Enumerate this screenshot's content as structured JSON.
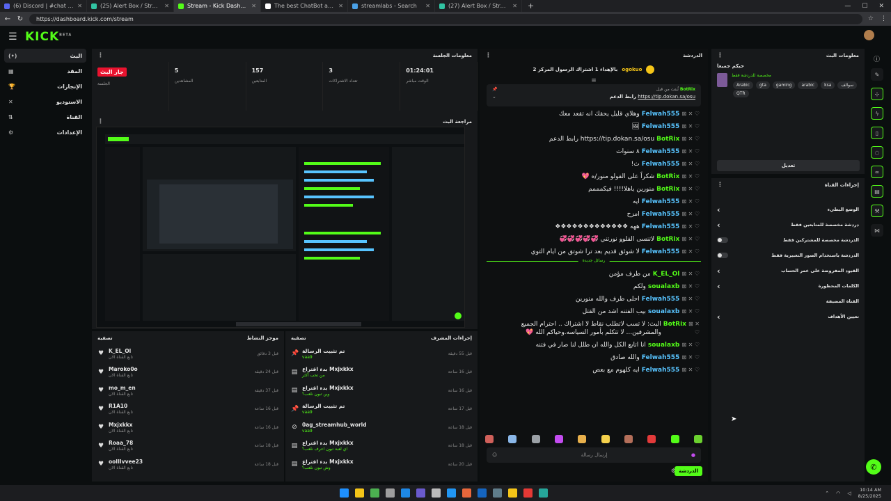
{
  "browser": {
    "tabs": [
      {
        "title": "(6) Discord | #chat | Vaa9",
        "color": "#5865f2",
        "active": false
      },
      {
        "title": "(25) Alert Box / Streamlabs",
        "color": "#31c3a2",
        "active": false
      },
      {
        "title": "Stream - Kick Dashboard",
        "color": "#53fc18",
        "active": true
      },
      {
        "title": "The best ChatBot and Widgets fo",
        "color": "#ffffff",
        "active": false
      },
      {
        "title": "streamlabs - Search",
        "color": "#4aa0e6",
        "active": false
      },
      {
        "title": "(27) Alert Box / Streamlabs",
        "color": "#31c3a2",
        "active": false
      }
    ],
    "url": "https://dashboard.kick.com/stream"
  },
  "app": {
    "logo": "KICK",
    "logo_sup": "BETA"
  },
  "sidebar": {
    "items": [
      {
        "label": "البث",
        "icon": "(•)"
      },
      {
        "label": "المقد",
        "icon": "▦"
      },
      {
        "label": "الإنجازات",
        "icon": "🏆"
      },
      {
        "label": "الاستوديو",
        "icon": "✕"
      },
      {
        "label": "القناة",
        "icon": "⇅"
      },
      {
        "label": "الإعدادات",
        "icon": "⚙"
      }
    ]
  },
  "session": {
    "title": "معلومات الجلسة",
    "stats": [
      {
        "value": "جار البث",
        "label": "الجلسة",
        "badge": true
      },
      {
        "value": "5",
        "label": "المشاهدين"
      },
      {
        "value": "157",
        "label": "المتابعين"
      },
      {
        "value": "3",
        "label": "تعداد الاشتراكات"
      },
      {
        "value": "01:24:01",
        "label": "الوقت مباشر"
      }
    ]
  },
  "preview": {
    "title": "مراجعة البث"
  },
  "activity": {
    "title": "موجز النشاط",
    "filter": "تصفية",
    "items": [
      {
        "name": "K_EL_Ol",
        "sub": "تابع القناة الان",
        "time": "قبل 3 دقائق"
      },
      {
        "name": "Maroko0o",
        "sub": "تابع القناة الان",
        "time": "قبل 24 دقيقة"
      },
      {
        "name": "mo_m_en",
        "sub": "تابع القناة الان",
        "time": "قبل 37 دقيقة"
      },
      {
        "name": "R1A10",
        "sub": "تابع القناة الان",
        "time": "قبل 16 ساعة"
      },
      {
        "name": "Mxjxkkx",
        "sub": "تابع القناة الان",
        "time": "قبل 16 ساعة"
      },
      {
        "name": "Roaa_78",
        "sub": "تابع القناة الان",
        "time": "قبل 18 ساعة"
      },
      {
        "name": "ooIIIvvee23",
        "sub": "تابع القناة الان",
        "time": "قبل 18 ساعة"
      }
    ]
  },
  "modlog": {
    "title": "إجراءات المشرف",
    "filter": "تصفية",
    "items": [
      {
        "icon": "📌",
        "name": "تم تثبيت الرسالة",
        "sub": "vaa9",
        "time": "قبل 55 دقيقة"
      },
      {
        "icon": "▤",
        "name": "بدء اقتراع Mxjxkkx",
        "sub": "من تحب أكثر",
        "time": "قبل 16 ساعة"
      },
      {
        "icon": "▤",
        "name": "بدء اقتراع Mxjxkkx",
        "sub": "وين تبون نلعب؟",
        "time": "قبل 16 ساعة"
      },
      {
        "icon": "📌",
        "name": "تم تثبيت الرسالة",
        "sub": "vaa9",
        "time": "قبل 17 ساعة"
      },
      {
        "icon": "⊘",
        "name": "0ag_streamhub_world",
        "sub": "vaa9",
        "time": "قبل 18 ساعة"
      },
      {
        "icon": "▤",
        "name": "بدء اقتراع Mxjxkkx",
        "sub": "اي لعبة تبون اعرف نلعب؟",
        "time": "قبل 18 ساعة"
      },
      {
        "icon": "▤",
        "name": "بدء اقتراع Mxjxkkx",
        "sub": "وش تبون نلعب؟",
        "time": "قبل 20 ساعة"
      }
    ]
  },
  "chat": {
    "title": "الدردشة",
    "gifter": {
      "name": "ogokuo",
      "count": "1",
      "text": "بالإهداء 1 اشتراك الرسول المركز 2"
    },
    "pinned": {
      "by": "BotRix",
      "tag": "ثُبتت من قبل",
      "link": "https://tip.dokan.sa/osu",
      "label": "رابط الدعم"
    },
    "messages": [
      {
        "user": "Felwah555",
        "text": "وهلاي قليل يحقك انه تقعد معك",
        "color": "blue"
      },
      {
        "user": "Felwah555",
        "text": "🖼",
        "color": "blue"
      },
      {
        "user": "BotRix",
        "text": "https://tip.dokan.sa/osu رابط الدعم",
        "color": "green"
      },
      {
        "user": "Felwah555",
        "text": "٨ سنوات",
        "color": "blue"
      },
      {
        "user": "Felwah555",
        "text": "ث!",
        "color": "blue"
      },
      {
        "user": "BotRix",
        "text": "شكراً على الفولو منور/ه 💖",
        "color": "green"
      },
      {
        "user": "BotRix",
        "text": "منورين ياهلا!!!! فيكمممم",
        "color": "green"
      },
      {
        "user": "Felwah555",
        "text": "ايه",
        "color": "blue"
      },
      {
        "user": "Felwah555",
        "text": "امزح",
        "color": "blue"
      },
      {
        "user": "Felwah555",
        "text": "ههه ❖❖❖❖❖❖❖❖❖❖❖❖❖",
        "color": "blue"
      },
      {
        "user": "BotRix",
        "text": "لاتنسى الفلوو نورتني 💞💞💞💞💞",
        "color": "green"
      },
      {
        "user": "Felwah555",
        "text": "لا شوئق قديم بعد ترا شوتق من ايام التوي",
        "color": "blue"
      }
    ],
    "new_divider": "رسائل جديدة",
    "messages2": [
      {
        "user": "K_EL_Ol",
        "text": "من طرف مؤمن",
        "color": "green"
      },
      {
        "user": "soualaxb",
        "text": "ولكم",
        "color": "green"
      },
      {
        "user": "Felwah555",
        "text": "احلى طرف والله منورين",
        "color": "blue"
      },
      {
        "user": "soualaxb",
        "text": "بيب الفتنه اشد من القتل",
        "color": "blue"
      },
      {
        "user": "BotRix",
        "text": "البث: لا تسب لاتطلب نقاط لا اشتراك .. احترام الجميع والمشرفين... لا تتكلم بأمور السياسه.وحياكم الله 💖",
        "color": "green"
      },
      {
        "user": "soualaxb",
        "text": "انا اتابع الكل والله ان طلل لنا صار في فتنه",
        "color": "green"
      },
      {
        "user": "Felwah555",
        "text": "والله صادق",
        "color": "blue"
      },
      {
        "user": "Felwah555",
        "text": "ايه كلهوم مع بعض",
        "color": "blue"
      }
    ],
    "placeholder": "إرسال رسالة",
    "send": "الدردشة"
  },
  "stream_info": {
    "title": "معلومات البث",
    "stream_title": "حيكم جميعا",
    "category": "مخصصة للدردشة فقط",
    "tags": [
      "Arabic",
      "gta",
      "gaming",
      "arabic",
      "ksa",
      "سوالف",
      "QTR"
    ],
    "edit": "تعديل"
  },
  "channel_actions": {
    "title": "إجراءات القناة",
    "items": [
      {
        "label": "الوضع البطيء",
        "type": "arrow"
      },
      {
        "label": "دردشة مخصصة للمتابعين فقط",
        "type": "arrow"
      },
      {
        "label": "الدردشة مخصصة للمشتركين فقط",
        "type": "toggle"
      },
      {
        "label": "الدردشة باستخدام الصور التعبيرية فقط",
        "type": "toggle"
      },
      {
        "label": "القيود المفروضة على عمر الحساب",
        "type": "arrow"
      },
      {
        "label": "الكلمات المحظورة",
        "type": "arrow"
      },
      {
        "label": "القناة المضيفة",
        "type": "none"
      },
      {
        "label": "تعيين الأهداف",
        "type": "arrow"
      }
    ]
  },
  "taskbar": {
    "time": "10:14 AM",
    "date": "8/25/2025"
  }
}
